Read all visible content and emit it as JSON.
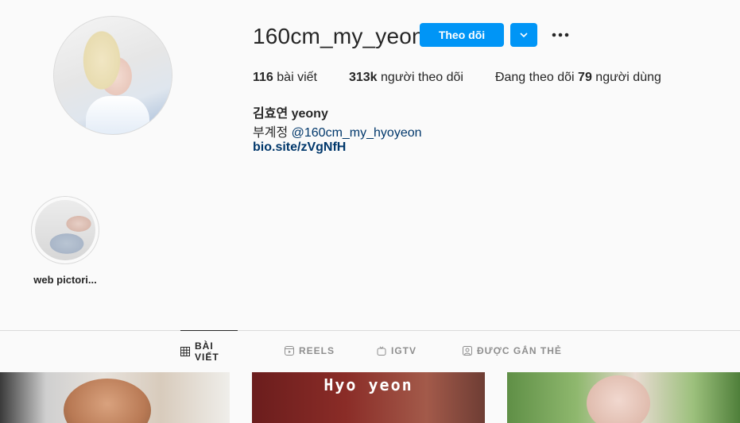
{
  "profile": {
    "username": "160cm_my_yeon",
    "follow_label": "Theo dõi",
    "stats": {
      "posts_count": "116",
      "posts_label": "bài viết",
      "followers_count": "313k",
      "followers_label": "người theo dõi",
      "following_prefix": "Đang theo dõi",
      "following_count": "79",
      "following_suffix": "người dùng"
    },
    "full_name": "김효연 yeony",
    "bio_prefix": "부계정",
    "bio_mention": "@160cm_my_hyoyeon",
    "bio_link": "bio.site/zVgNfH"
  },
  "highlights": [
    {
      "label": "web pictori..."
    }
  ],
  "tabs": [
    {
      "label": "BÀI VIẾT",
      "icon": "grid-icon",
      "active": true
    },
    {
      "label": "REELS",
      "icon": "reels-icon",
      "active": false
    },
    {
      "label": "IGTV",
      "icon": "igtv-icon",
      "active": false
    },
    {
      "label": "ĐƯỢC GẮN THẺ",
      "icon": "tagged-icon",
      "active": false
    }
  ],
  "posts": [
    {
      "overlay_text": ""
    },
    {
      "overlay_text": "Hyo yeon"
    },
    {
      "overlay_text": ""
    }
  ],
  "colors": {
    "accent": "#0095f6",
    "link": "#00376b",
    "text": "#262626",
    "muted": "#8e8e8e",
    "background": "#fafafa"
  }
}
